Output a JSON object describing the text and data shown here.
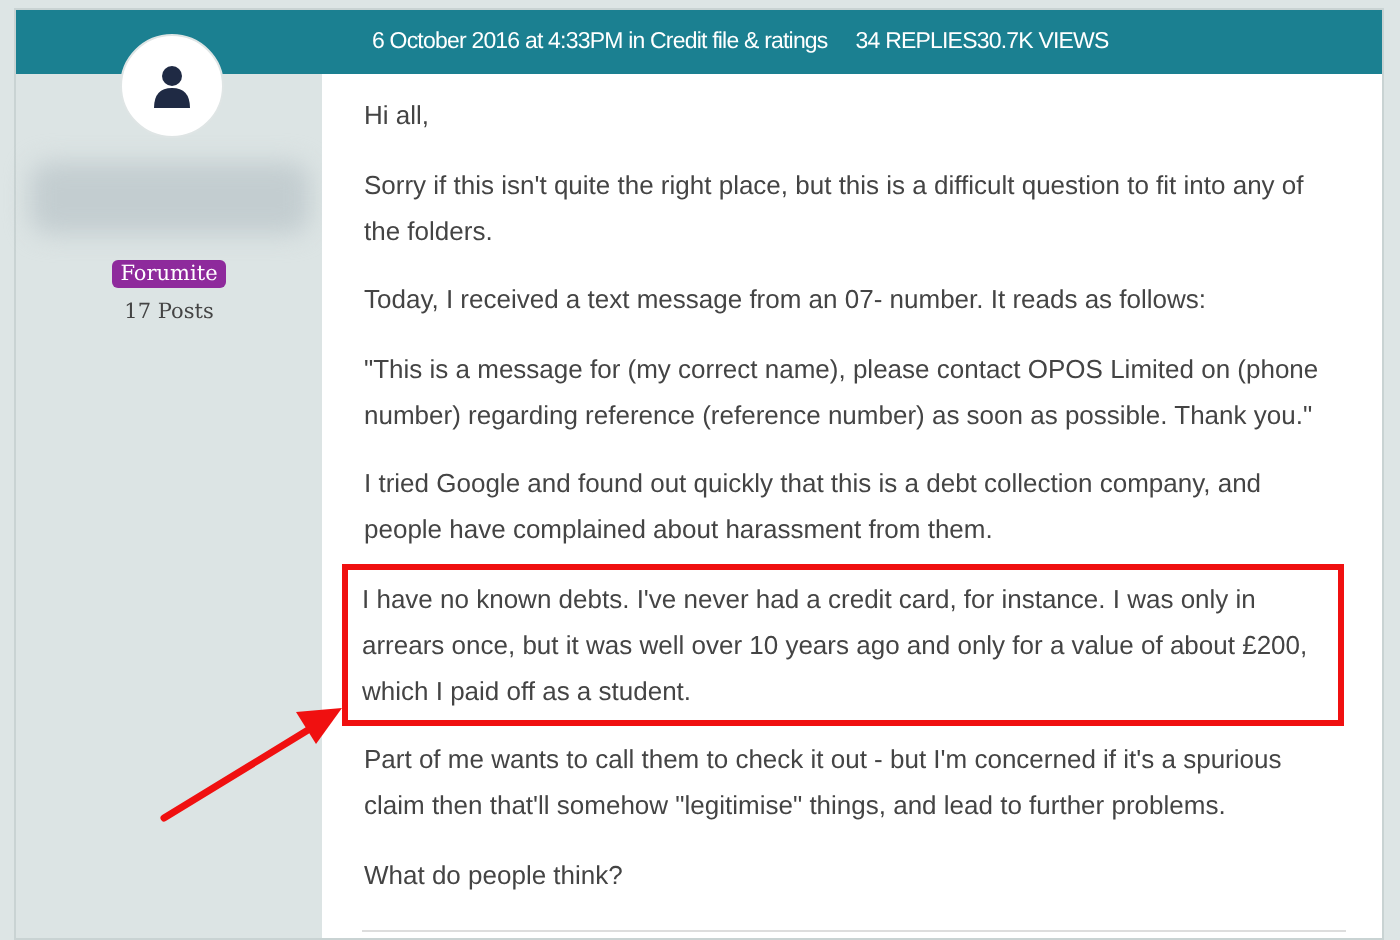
{
  "header": {
    "meta": "6 October 2016 at 4:33PM in Credit file & ratings",
    "stats": "34 REPLIES30.7K VIEWS"
  },
  "author": {
    "badge": "Forumite",
    "posts": "17 Posts"
  },
  "paragraphs": [
    {
      "text": "Hi all,",
      "highlighted": false
    },
    {
      "text": "Sorry if this isn't quite the right place, but this is a difficult question to fit into any of the folders.",
      "highlighted": false
    },
    {
      "text": "Today, I received a text message from an 07- number. It reads as follows:",
      "highlighted": false
    },
    {
      "text": "\"This is a message for (my correct name), please contact OPOS Limited on (phone number) regarding reference (reference number) as soon as possible. Thank you.\"",
      "highlighted": false
    },
    {
      "text": "I tried Google and found out quickly that this is a debt collection company, and people have complained about harassment from them.",
      "highlighted": false
    },
    {
      "text": "I have no known debts. I've never had a credit card, for instance. I was only in arrears once, but it was well over 10 years ago and only for a value of about £200, which I paid off as a student.",
      "highlighted": true
    },
    {
      "text": "Part of me wants to call them to check it out - but I'm concerned if it's a spurious claim then that'll somehow \"legitimise\" things, and lead to further problems.",
      "highlighted": false
    },
    {
      "text": "What do people think?",
      "highlighted": false
    }
  ]
}
